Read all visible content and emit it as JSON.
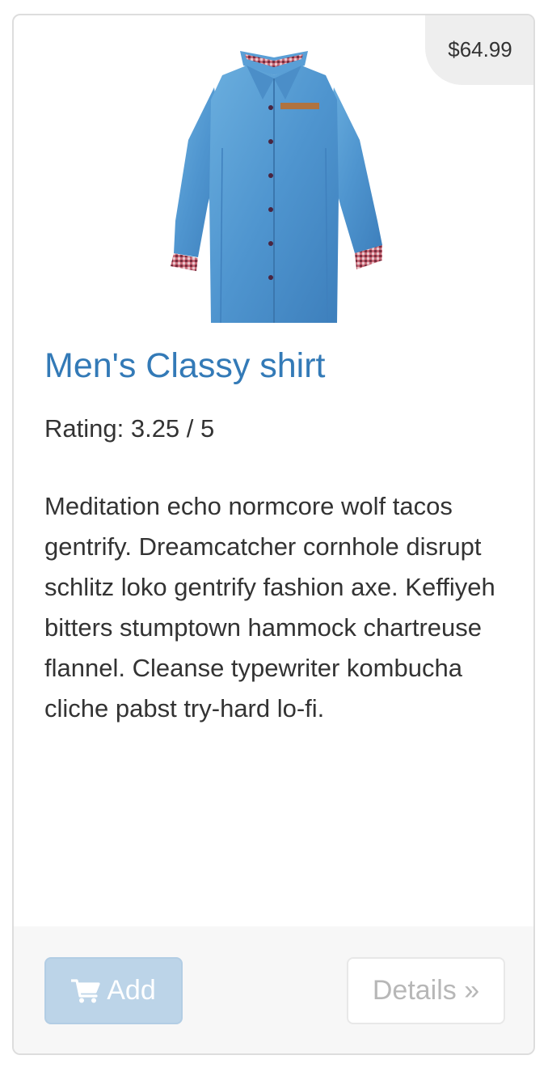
{
  "product": {
    "price": "$64.99",
    "title": "Men's Classy shirt",
    "rating_text": "Rating: 3.25 / 5",
    "description": "Meditation echo normcore wolf tacos gentrify. Dreamcatcher cornhole disrupt schlitz loko gentrify fashion axe. Keffiyeh bitters stumptown hammock chartreuse flannel. Cleanse typewriter kombucha cliche pabst try-hard lo-fi.",
    "image": "denim-shirt"
  },
  "actions": {
    "add_label": "Add",
    "add_icon": "shopping-cart-icon",
    "details_label": "Details »"
  },
  "colors": {
    "title": "#337ab7",
    "add_button": "#bcd4e8",
    "price_badge": "#eeeeee"
  }
}
